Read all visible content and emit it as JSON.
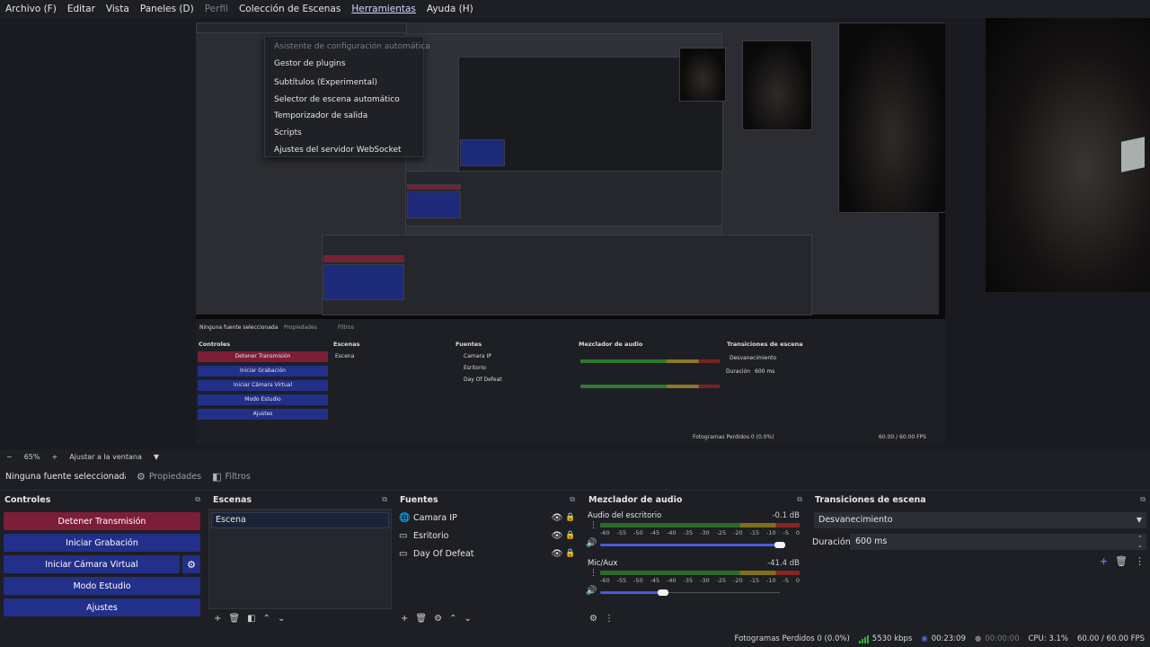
{
  "menubar": {
    "items": [
      "Archivo (F)",
      "Editar",
      "Vista",
      "Paneles (D)",
      "Perfil",
      "Colección de Escenas",
      "Herramientas",
      "Ayuda (H)"
    ]
  },
  "tools_menu": {
    "items": [
      "Asistente de configuración automática",
      "Gestor de plugins",
      "Subtítulos (Experimental)",
      "Selector de escena automático",
      "Temporizador de salida",
      "Scripts",
      "Ajustes del servidor WebSocket"
    ]
  },
  "zoom": {
    "minus": "−",
    "level": "65%",
    "plus": "+",
    "fit": "Ajustar a la ventana",
    "arrow": "▼"
  },
  "context": {
    "source": "Ninguna fuente seleccionada",
    "properties": "Propiedades",
    "filters": "Filtros"
  },
  "controls": {
    "title": "Controles",
    "stop_stream": "Detener Transmisión",
    "start_record": "Iniciar Grabación",
    "start_vcam": "Iniciar Cámara Virtual",
    "studio": "Modo Estudio",
    "settings": "Ajustes"
  },
  "scenes": {
    "title": "Escenas",
    "items": [
      "Escena"
    ]
  },
  "sources": {
    "title": "Fuentes",
    "items": [
      "Camara IP",
      "Esritorio",
      "Day Of Defeat"
    ]
  },
  "mixer": {
    "title": "Mezclador de audio",
    "ticks": [
      "-60",
      "-55",
      "-50",
      "-45",
      "-40",
      "-35",
      "-30",
      "-25",
      "-20",
      "-15",
      "-10",
      "-5",
      "0"
    ],
    "channels": [
      {
        "name": "Audio del escritorio",
        "db": "-0.1 dB",
        "volume": 1.0
      },
      {
        "name": "Mic/Aux",
        "db": "-41.4 dB",
        "volume": 0.35
      }
    ]
  },
  "transitions": {
    "title": "Transiciones de escena",
    "selected": "Desvanecimiento",
    "duration_label": "Duración",
    "duration_value": "600 ms"
  },
  "status": {
    "dropped": "Fotogramas Perdidos 0 (0.0%)",
    "bitrate": "5530 kbps",
    "stream_time": "00:23:09",
    "record_time": "00:00:00",
    "cpu": "CPU: 3.1%",
    "fps": "60.00 / 60.00 FPS"
  },
  "colors": {
    "accent": "#22308a",
    "danger": "#7c1e38",
    "fader": "#4b5bd6"
  }
}
